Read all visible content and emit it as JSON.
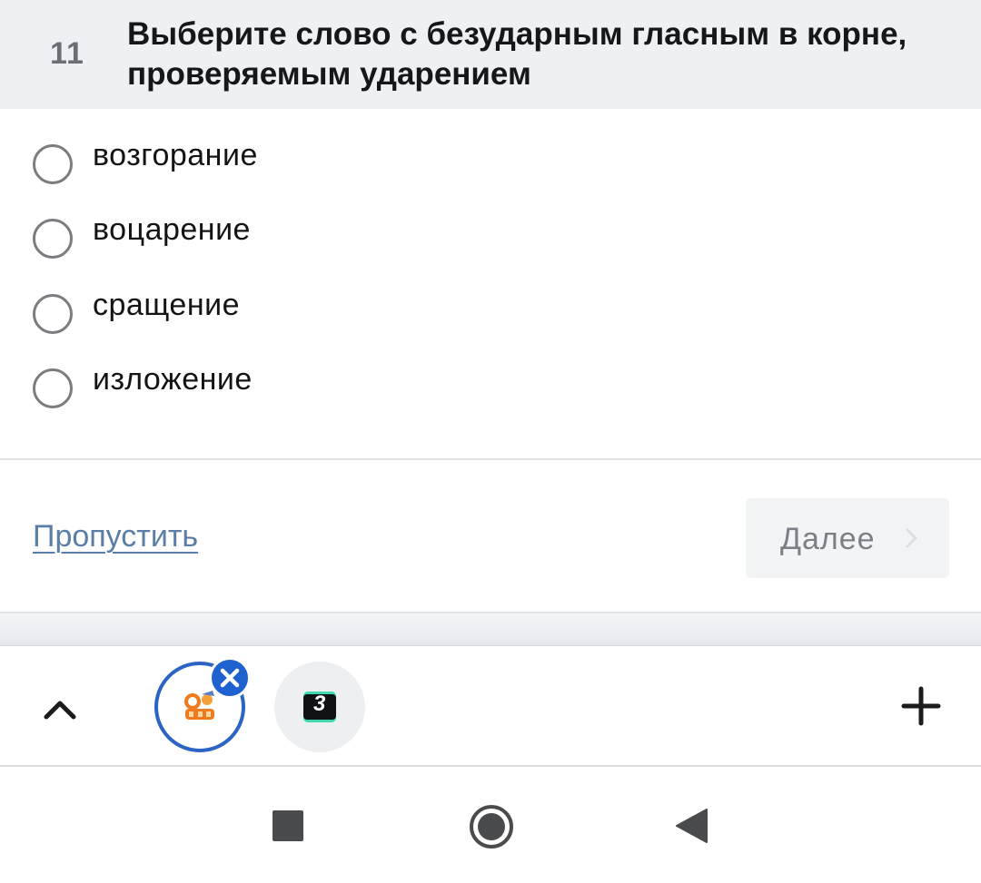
{
  "question": {
    "number": "11",
    "text": "Выберите слово с безударным гласным в корне, проверяемым ударением"
  },
  "options": [
    {
      "label": "возгорание",
      "selected": false
    },
    {
      "label": "воцарение",
      "selected": false
    },
    {
      "label": "сращение",
      "selected": false
    },
    {
      "label": "изложение",
      "selected": false
    }
  ],
  "actions": {
    "skip_label": "Пропустить",
    "next_label": "Далее"
  },
  "tabbar": {
    "tab_two_badge": "3"
  },
  "colors": {
    "accent": "#1e62d0",
    "link": "#5b7ea6",
    "header_bg": "#eef0f4"
  },
  "icons": [
    "chevron-up-icon",
    "close-icon",
    "plus-icon",
    "chevron-right-icon",
    "square-icon",
    "circle-icon",
    "triangle-back-icon"
  ]
}
